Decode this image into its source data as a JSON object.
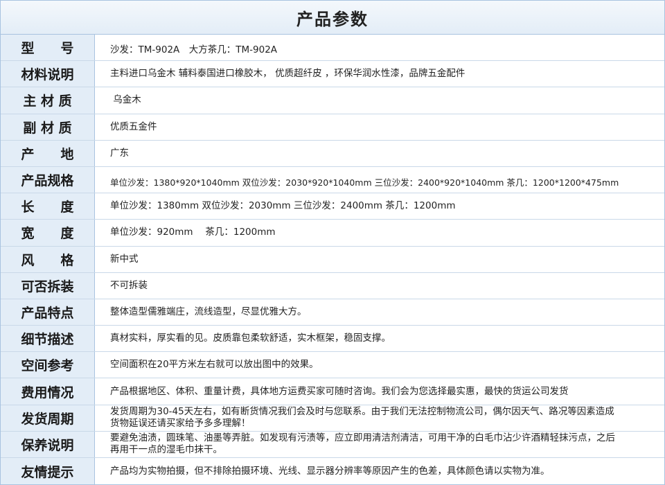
{
  "title": "产品参数",
  "params": [
    {
      "label": "型　　号",
      "value": "沙发：TM-902A　大方茶几：TM-902A"
    },
    {
      "label": "材料说明",
      "value": "主料进口乌金木 辅料泰国进口橡胶木， 优质超纤皮 ，环保华润水性漆，品牌五金配件"
    },
    {
      "label": "主 材 质",
      "value": " 乌金木"
    },
    {
      "label": "副 材 质",
      "value": "优质五金件"
    },
    {
      "label": "产　　地",
      "value": "广东"
    },
    {
      "label": "产品规格",
      "value": "单位沙发：1380*920*1040mm 双位沙发：2030*920*1040mm 三位沙发：2400*920*1040mm 茶几：1200*1200*475mm"
    },
    {
      "label": "长　　度",
      "value": "单位沙发：1380mm 双位沙发：2030mm 三位沙发：2400mm 茶几：1200mm"
    },
    {
      "label": "宽　　度",
      "value": "单位沙发：920mm　 茶几：1200mm"
    },
    {
      "label": "风　　格",
      "value": "新中式"
    },
    {
      "label": "可否拆装",
      "value": "不可拆装"
    },
    {
      "label": "产品特点",
      "value": "整体造型儒雅端庄，流线造型，尽显优雅大方。"
    },
    {
      "label": "细节描述",
      "value": "真材实料，厚实看的见。皮质靠包柔软舒适，实木框架，稳固支撑。"
    },
    {
      "label": "空间参考",
      "value": "空间面积在20平方米左右就可以放出图中的效果。"
    },
    {
      "label": "费用情况",
      "value": "产品根据地区、体积、重量计费，具体地方运费买家可随时咨询。我们会为您选择最实惠，最快的货运公司发货"
    },
    {
      "label": "发货周期",
      "value": "发货周期为30-45天左右，如有断货情况我们会及时与您联系。由于我们无法控制物流公司，偶尔因天气、路况等因素造成货物延误还请买家给予多多理解！"
    },
    {
      "label": "保养说明",
      "value": "要避免油渍，圆珠笔、油墨等弄脏。如发现有污渍等，应立即用清洁剂清洁，可用干净的白毛巾沾少许酒精轻抹污点，之后再用干一点的湿毛巾抹干。"
    },
    {
      "label": "友情提示",
      "value": "产品均为实物拍摄，但不排除拍摄环境、光线、显示器分辨率等原因产生的色差，具体颜色请以实物为准。"
    }
  ]
}
